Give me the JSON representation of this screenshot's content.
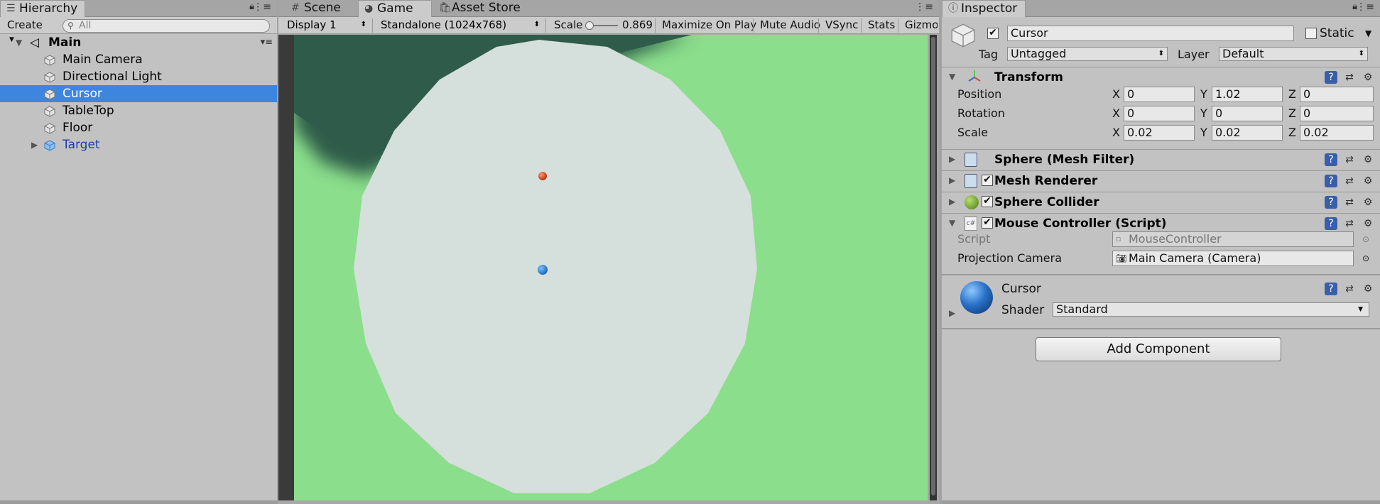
{
  "hierarchy": {
    "tab_label": "Hierarchy",
    "create_label": "Create",
    "search_placeholder": "All",
    "scene_name": "Main",
    "items": [
      {
        "label": "Main Camera"
      },
      {
        "label": "Directional Light"
      },
      {
        "label": "Cursor"
      },
      {
        "label": "TableTop"
      },
      {
        "label": "Floor"
      },
      {
        "label": "Target"
      }
    ]
  },
  "center": {
    "tabs": [
      {
        "label": "Scene",
        "icon": "grid-icon"
      },
      {
        "label": "Game",
        "icon": "pacman-icon"
      },
      {
        "label": "Asset Store",
        "icon": "bag-icon"
      }
    ],
    "display_label": "Display 1",
    "resolution_label": "Standalone (1024x768)",
    "scale_label": "Scale",
    "scale_value": "0.869",
    "maximize_label": "Maximize On Play",
    "mute_label": "Mute Audio",
    "vsync_label": "VSync",
    "stats_label": "Stats",
    "gizmos_label": "Gizmo"
  },
  "inspector": {
    "tab_label": "Inspector",
    "object_name": "Cursor",
    "static_label": "Static",
    "tag_label": "Tag",
    "tag_value": "Untagged",
    "layer_label": "Layer",
    "layer_value": "Default",
    "transform": {
      "title": "Transform",
      "position_label": "Position",
      "rotation_label": "Rotation",
      "scale_label": "Scale",
      "x": "X",
      "y": "Y",
      "z": "Z",
      "position": [
        "0",
        "1.02",
        "0"
      ],
      "rotation": [
        "0",
        "0",
        "0"
      ],
      "scale": [
        "0.02",
        "0.02",
        "0.02"
      ]
    },
    "components": [
      {
        "title": "Sphere (Mesh Filter)"
      },
      {
        "title": "Mesh Renderer"
      },
      {
        "title": "Sphere Collider"
      },
      {
        "title": "Mouse Controller (Script)"
      }
    ],
    "script_label": "Script",
    "script_value": "MouseController",
    "camera_label": "Projection Camera",
    "camera_value": "Main Camera (Camera)",
    "material_name": "Cursor",
    "shader_label": "Shader",
    "shader_value": "Standard",
    "add_component_label": "Add Component"
  },
  "colors": {
    "selection": "#3d86e0",
    "ground": "#8bde8b",
    "table": "#d5dfdb",
    "dark_green": "#2f5c4a",
    "cursor_sphere": "#2a7ed8",
    "target_sphere": "#d8431c"
  }
}
